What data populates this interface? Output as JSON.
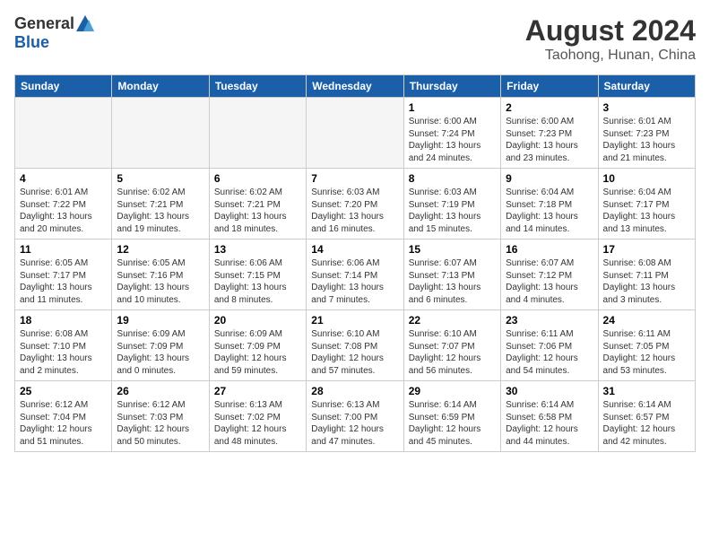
{
  "logo": {
    "general": "General",
    "blue": "Blue"
  },
  "title": "August 2024",
  "location": "Taohong, Hunan, China",
  "days_of_week": [
    "Sunday",
    "Monday",
    "Tuesday",
    "Wednesday",
    "Thursday",
    "Friday",
    "Saturday"
  ],
  "weeks": [
    [
      {
        "day": "",
        "info": ""
      },
      {
        "day": "",
        "info": ""
      },
      {
        "day": "",
        "info": ""
      },
      {
        "day": "",
        "info": ""
      },
      {
        "day": "1",
        "info": "Sunrise: 6:00 AM\nSunset: 7:24 PM\nDaylight: 13 hours\nand 24 minutes."
      },
      {
        "day": "2",
        "info": "Sunrise: 6:00 AM\nSunset: 7:23 PM\nDaylight: 13 hours\nand 23 minutes."
      },
      {
        "day": "3",
        "info": "Sunrise: 6:01 AM\nSunset: 7:23 PM\nDaylight: 13 hours\nand 21 minutes."
      }
    ],
    [
      {
        "day": "4",
        "info": "Sunrise: 6:01 AM\nSunset: 7:22 PM\nDaylight: 13 hours\nand 20 minutes."
      },
      {
        "day": "5",
        "info": "Sunrise: 6:02 AM\nSunset: 7:21 PM\nDaylight: 13 hours\nand 19 minutes."
      },
      {
        "day": "6",
        "info": "Sunrise: 6:02 AM\nSunset: 7:21 PM\nDaylight: 13 hours\nand 18 minutes."
      },
      {
        "day": "7",
        "info": "Sunrise: 6:03 AM\nSunset: 7:20 PM\nDaylight: 13 hours\nand 16 minutes."
      },
      {
        "day": "8",
        "info": "Sunrise: 6:03 AM\nSunset: 7:19 PM\nDaylight: 13 hours\nand 15 minutes."
      },
      {
        "day": "9",
        "info": "Sunrise: 6:04 AM\nSunset: 7:18 PM\nDaylight: 13 hours\nand 14 minutes."
      },
      {
        "day": "10",
        "info": "Sunrise: 6:04 AM\nSunset: 7:17 PM\nDaylight: 13 hours\nand 13 minutes."
      }
    ],
    [
      {
        "day": "11",
        "info": "Sunrise: 6:05 AM\nSunset: 7:17 PM\nDaylight: 13 hours\nand 11 minutes."
      },
      {
        "day": "12",
        "info": "Sunrise: 6:05 AM\nSunset: 7:16 PM\nDaylight: 13 hours\nand 10 minutes."
      },
      {
        "day": "13",
        "info": "Sunrise: 6:06 AM\nSunset: 7:15 PM\nDaylight: 13 hours\nand 8 minutes."
      },
      {
        "day": "14",
        "info": "Sunrise: 6:06 AM\nSunset: 7:14 PM\nDaylight: 13 hours\nand 7 minutes."
      },
      {
        "day": "15",
        "info": "Sunrise: 6:07 AM\nSunset: 7:13 PM\nDaylight: 13 hours\nand 6 minutes."
      },
      {
        "day": "16",
        "info": "Sunrise: 6:07 AM\nSunset: 7:12 PM\nDaylight: 13 hours\nand 4 minutes."
      },
      {
        "day": "17",
        "info": "Sunrise: 6:08 AM\nSunset: 7:11 PM\nDaylight: 13 hours\nand 3 minutes."
      }
    ],
    [
      {
        "day": "18",
        "info": "Sunrise: 6:08 AM\nSunset: 7:10 PM\nDaylight: 13 hours\nand 2 minutes."
      },
      {
        "day": "19",
        "info": "Sunrise: 6:09 AM\nSunset: 7:09 PM\nDaylight: 13 hours\nand 0 minutes."
      },
      {
        "day": "20",
        "info": "Sunrise: 6:09 AM\nSunset: 7:09 PM\nDaylight: 12 hours\nand 59 minutes."
      },
      {
        "day": "21",
        "info": "Sunrise: 6:10 AM\nSunset: 7:08 PM\nDaylight: 12 hours\nand 57 minutes."
      },
      {
        "day": "22",
        "info": "Sunrise: 6:10 AM\nSunset: 7:07 PM\nDaylight: 12 hours\nand 56 minutes."
      },
      {
        "day": "23",
        "info": "Sunrise: 6:11 AM\nSunset: 7:06 PM\nDaylight: 12 hours\nand 54 minutes."
      },
      {
        "day": "24",
        "info": "Sunrise: 6:11 AM\nSunset: 7:05 PM\nDaylight: 12 hours\nand 53 minutes."
      }
    ],
    [
      {
        "day": "25",
        "info": "Sunrise: 6:12 AM\nSunset: 7:04 PM\nDaylight: 12 hours\nand 51 minutes."
      },
      {
        "day": "26",
        "info": "Sunrise: 6:12 AM\nSunset: 7:03 PM\nDaylight: 12 hours\nand 50 minutes."
      },
      {
        "day": "27",
        "info": "Sunrise: 6:13 AM\nSunset: 7:02 PM\nDaylight: 12 hours\nand 48 minutes."
      },
      {
        "day": "28",
        "info": "Sunrise: 6:13 AM\nSunset: 7:00 PM\nDaylight: 12 hours\nand 47 minutes."
      },
      {
        "day": "29",
        "info": "Sunrise: 6:14 AM\nSunset: 6:59 PM\nDaylight: 12 hours\nand 45 minutes."
      },
      {
        "day": "30",
        "info": "Sunrise: 6:14 AM\nSunset: 6:58 PM\nDaylight: 12 hours\nand 44 minutes."
      },
      {
        "day": "31",
        "info": "Sunrise: 6:14 AM\nSunset: 6:57 PM\nDaylight: 12 hours\nand 42 minutes."
      }
    ]
  ]
}
